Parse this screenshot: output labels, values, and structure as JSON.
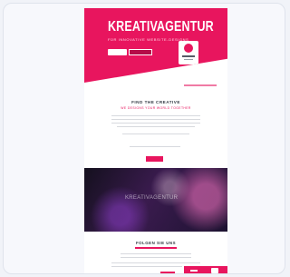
{
  "hero": {
    "title": "KREATIVAGENTUR",
    "subtitle": "FÜR INNOVATIVE WEBSITE-DESIGNS"
  },
  "intro": {
    "title": "FIND THE CREATIVE",
    "subtitle": "WE DESIGNS YOUR WORLD TOGETHER"
  },
  "banner": {
    "caption": "KREATIVAGENTUR"
  },
  "footer": {
    "title": "FOLGEN SIE UNS"
  },
  "colors": {
    "accent": "#e8155e",
    "text_dark": "#333a44",
    "card_bg": "#f7f8fc"
  }
}
